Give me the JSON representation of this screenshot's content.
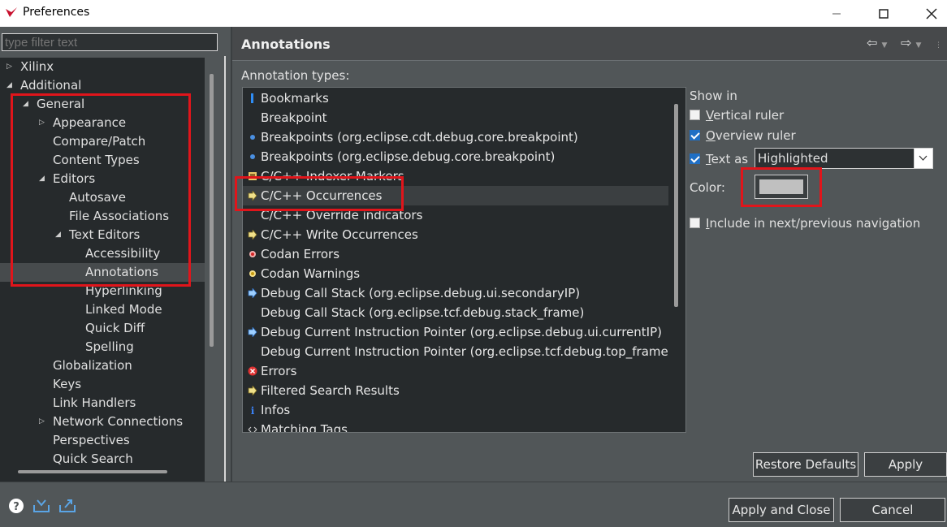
{
  "window": {
    "title": "Preferences"
  },
  "filter": {
    "placeholder": "type filter text"
  },
  "tree": {
    "items": [
      {
        "label": "Xilinx",
        "level": 0,
        "twisty": "collapsed"
      },
      {
        "label": "Additional",
        "level": 0,
        "twisty": "expanded"
      },
      {
        "label": "General",
        "level": 1,
        "twisty": "expanded"
      },
      {
        "label": "Appearance",
        "level": 2,
        "twisty": "collapsed"
      },
      {
        "label": "Compare/Patch",
        "level": 2,
        "twisty": "none"
      },
      {
        "label": "Content Types",
        "level": 2,
        "twisty": "none"
      },
      {
        "label": "Editors",
        "level": 2,
        "twisty": "expanded"
      },
      {
        "label": "Autosave",
        "level": 3,
        "twisty": "none"
      },
      {
        "label": "File Associations",
        "level": 3,
        "twisty": "none"
      },
      {
        "label": "Text Editors",
        "level": 3,
        "twisty": "expanded"
      },
      {
        "label": "Accessibility",
        "level": 4,
        "twisty": "none"
      },
      {
        "label": "Annotations",
        "level": 4,
        "twisty": "none",
        "selected": true
      },
      {
        "label": "Hyperlinking",
        "level": 4,
        "twisty": "none"
      },
      {
        "label": "Linked Mode",
        "level": 4,
        "twisty": "none"
      },
      {
        "label": "Quick Diff",
        "level": 4,
        "twisty": "none"
      },
      {
        "label": "Spelling",
        "level": 4,
        "twisty": "none"
      },
      {
        "label": "Globalization",
        "level": 2,
        "twisty": "none"
      },
      {
        "label": "Keys",
        "level": 2,
        "twisty": "none"
      },
      {
        "label": "Link Handlers",
        "level": 2,
        "twisty": "none"
      },
      {
        "label": "Network Connections",
        "level": 2,
        "twisty": "collapsed"
      },
      {
        "label": "Perspectives",
        "level": 2,
        "twisty": "none"
      },
      {
        "label": "Quick Search",
        "level": 2,
        "twisty": "none"
      }
    ]
  },
  "page": {
    "title": "Annotations",
    "nav_back": "⇦",
    "nav_forward": "⇨",
    "annotation_types_label": "Annotation types:"
  },
  "annotations": [
    {
      "label": "Bookmarks",
      "icon": "bookmark-icon"
    },
    {
      "label": "Breakpoint",
      "icon": "none"
    },
    {
      "label": "Breakpoints (org.eclipse.cdt.debug.core.breakpoint)",
      "icon": "breakpoint-dot-icon"
    },
    {
      "label": "Breakpoints (org.eclipse.debug.core.breakpoint)",
      "icon": "breakpoint-dot-icon"
    },
    {
      "label": "C/C++ Indexer Markers",
      "icon": "indexer-marker-icon"
    },
    {
      "label": "C/C++ Occurrences",
      "icon": "occurrence-arrow-icon",
      "selected": true
    },
    {
      "label": "C/C++ Override indicators",
      "icon": "none"
    },
    {
      "label": "C/C++ Write Occurrences",
      "icon": "occurrence-arrow-icon"
    },
    {
      "label": "Codan Errors",
      "icon": "codan-error-icon"
    },
    {
      "label": "Codan Warnings",
      "icon": "codan-warning-icon"
    },
    {
      "label": "Debug Call Stack (org.eclipse.debug.ui.secondaryIP)",
      "icon": "instruction-pointer-icon"
    },
    {
      "label": "Debug Call Stack (org.eclipse.tcf.debug.stack_frame)",
      "icon": "none"
    },
    {
      "label": "Debug Current Instruction Pointer (org.eclipse.debug.ui.currentIP)",
      "icon": "instruction-pointer-icon"
    },
    {
      "label": "Debug Current Instruction Pointer (org.eclipse.tcf.debug.top_frame)",
      "icon": "none"
    },
    {
      "label": "Errors",
      "icon": "error-icon"
    },
    {
      "label": "Filtered Search Results",
      "icon": "occurrence-arrow-icon"
    },
    {
      "label": "Infos",
      "icon": "info-icon"
    },
    {
      "label": "Matching Tags",
      "icon": "matching-tags-icon"
    }
  ],
  "options": {
    "show_in_label": "Show in",
    "vertical_ruler": {
      "label": "Vertical ruler",
      "checked": false
    },
    "overview_ruler": {
      "label": "Overview ruler",
      "checked": true
    },
    "text_as": {
      "label": "Text as",
      "checked": true,
      "value": "Highlighted"
    },
    "color_label": "Color:",
    "color_value": "#c0c0c0",
    "include_navigation": {
      "label": "Include in next/previous navigation",
      "checked": false
    }
  },
  "buttons": {
    "restore_defaults": "Restore Defaults",
    "apply": "Apply",
    "apply_and_close": "Apply and Close",
    "cancel": "Cancel"
  },
  "colors": {
    "background": "#515658",
    "tree_background": "#262a2c",
    "highlight_box": "#e0151b",
    "checkbox_on": "#1f6fc5"
  }
}
